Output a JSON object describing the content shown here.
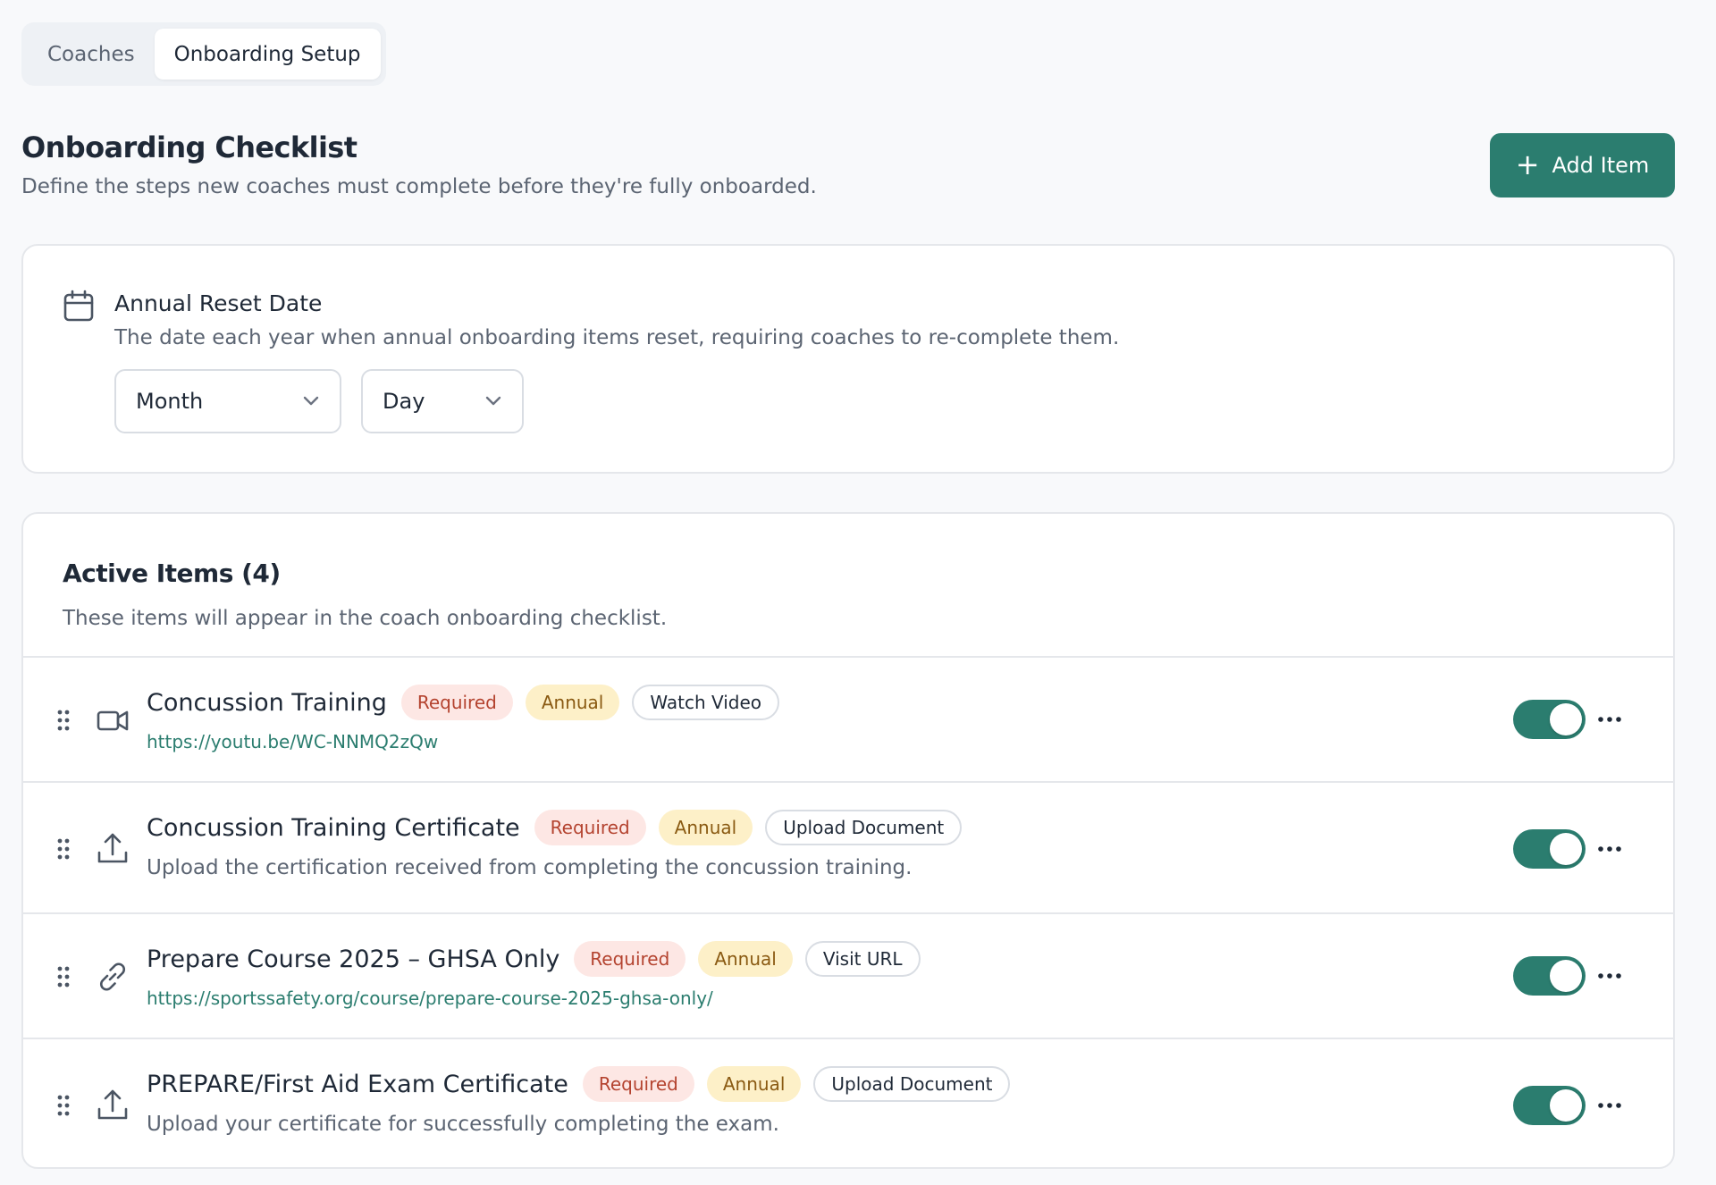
{
  "tabs": [
    {
      "label": "Coaches",
      "active": false
    },
    {
      "label": "Onboarding Setup",
      "active": true
    }
  ],
  "header": {
    "title": "Onboarding Checklist",
    "subtitle": "Define the steps new coaches must complete before they're fully onboarded.",
    "add_button": "Add Item"
  },
  "reset": {
    "title": "Annual Reset Date",
    "description": "The date each year when annual onboarding items reset, requiring coaches to re-complete them.",
    "month_placeholder": "Month",
    "day_placeholder": "Day",
    "icon": "calendar-icon"
  },
  "items": {
    "title": "Active Items (4)",
    "description": "These items will appear in the coach onboarding checklist.",
    "rows": [
      {
        "title": "Concussion Training",
        "badges": [
          "Required",
          "Annual",
          "Watch Video"
        ],
        "sub": "https://youtu.be/WC-NNMQ2zQw",
        "sub_type": "link",
        "icon": "video-icon",
        "enabled": true
      },
      {
        "title": "Concussion Training Certificate",
        "badges": [
          "Required",
          "Annual",
          "Upload Document"
        ],
        "sub": "Upload the certification received from completing the concussion training.",
        "sub_type": "text",
        "icon": "upload-icon",
        "enabled": true
      },
      {
        "title": "Prepare Course 2025 – GHSA Only",
        "badges": [
          "Required",
          "Annual",
          "Visit URL"
        ],
        "sub": "https://sportssafety.org/course/prepare-course-2025-ghsa-only/",
        "sub_type": "link",
        "icon": "link-icon",
        "enabled": true
      },
      {
        "title": "PREPARE/First Aid Exam Certificate",
        "badges": [
          "Required",
          "Annual",
          "Upload Document"
        ],
        "sub": "Upload your certificate for successfully completing the exam.",
        "sub_type": "text",
        "icon": "upload-icon",
        "enabled": true
      }
    ]
  },
  "colors": {
    "accent": "#2b7d6f",
    "required_bg": "#fde7e4",
    "required_fg": "#b4432f",
    "annual_bg": "#fdf0c8",
    "annual_fg": "#8a5a12"
  }
}
